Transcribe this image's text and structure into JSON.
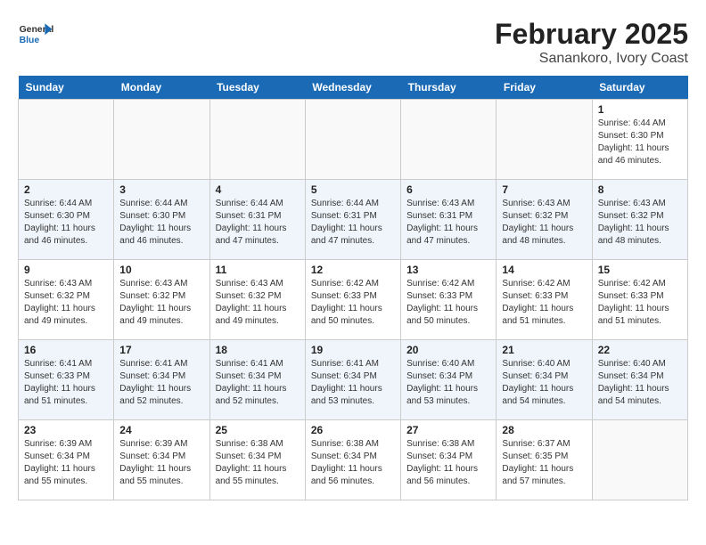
{
  "logo": {
    "general": "General",
    "blue": "Blue"
  },
  "title": "February 2025",
  "location": "Sanankoro, Ivory Coast",
  "days_of_week": [
    "Sunday",
    "Monday",
    "Tuesday",
    "Wednesday",
    "Thursday",
    "Friday",
    "Saturday"
  ],
  "weeks": [
    {
      "days": [
        {
          "num": "",
          "info": ""
        },
        {
          "num": "",
          "info": ""
        },
        {
          "num": "",
          "info": ""
        },
        {
          "num": "",
          "info": ""
        },
        {
          "num": "",
          "info": ""
        },
        {
          "num": "",
          "info": ""
        },
        {
          "num": "1",
          "info": "Sunrise: 6:44 AM\nSunset: 6:30 PM\nDaylight: 11 hours and 46 minutes."
        }
      ]
    },
    {
      "days": [
        {
          "num": "2",
          "info": "Sunrise: 6:44 AM\nSunset: 6:30 PM\nDaylight: 11 hours and 46 minutes."
        },
        {
          "num": "3",
          "info": "Sunrise: 6:44 AM\nSunset: 6:30 PM\nDaylight: 11 hours and 46 minutes."
        },
        {
          "num": "4",
          "info": "Sunrise: 6:44 AM\nSunset: 6:31 PM\nDaylight: 11 hours and 47 minutes."
        },
        {
          "num": "5",
          "info": "Sunrise: 6:44 AM\nSunset: 6:31 PM\nDaylight: 11 hours and 47 minutes."
        },
        {
          "num": "6",
          "info": "Sunrise: 6:43 AM\nSunset: 6:31 PM\nDaylight: 11 hours and 47 minutes."
        },
        {
          "num": "7",
          "info": "Sunrise: 6:43 AM\nSunset: 6:32 PM\nDaylight: 11 hours and 48 minutes."
        },
        {
          "num": "8",
          "info": "Sunrise: 6:43 AM\nSunset: 6:32 PM\nDaylight: 11 hours and 48 minutes."
        }
      ]
    },
    {
      "days": [
        {
          "num": "9",
          "info": "Sunrise: 6:43 AM\nSunset: 6:32 PM\nDaylight: 11 hours and 49 minutes."
        },
        {
          "num": "10",
          "info": "Sunrise: 6:43 AM\nSunset: 6:32 PM\nDaylight: 11 hours and 49 minutes."
        },
        {
          "num": "11",
          "info": "Sunrise: 6:43 AM\nSunset: 6:32 PM\nDaylight: 11 hours and 49 minutes."
        },
        {
          "num": "12",
          "info": "Sunrise: 6:42 AM\nSunset: 6:33 PM\nDaylight: 11 hours and 50 minutes."
        },
        {
          "num": "13",
          "info": "Sunrise: 6:42 AM\nSunset: 6:33 PM\nDaylight: 11 hours and 50 minutes."
        },
        {
          "num": "14",
          "info": "Sunrise: 6:42 AM\nSunset: 6:33 PM\nDaylight: 11 hours and 51 minutes."
        },
        {
          "num": "15",
          "info": "Sunrise: 6:42 AM\nSunset: 6:33 PM\nDaylight: 11 hours and 51 minutes."
        }
      ]
    },
    {
      "days": [
        {
          "num": "16",
          "info": "Sunrise: 6:41 AM\nSunset: 6:33 PM\nDaylight: 11 hours and 51 minutes."
        },
        {
          "num": "17",
          "info": "Sunrise: 6:41 AM\nSunset: 6:34 PM\nDaylight: 11 hours and 52 minutes."
        },
        {
          "num": "18",
          "info": "Sunrise: 6:41 AM\nSunset: 6:34 PM\nDaylight: 11 hours and 52 minutes."
        },
        {
          "num": "19",
          "info": "Sunrise: 6:41 AM\nSunset: 6:34 PM\nDaylight: 11 hours and 53 minutes."
        },
        {
          "num": "20",
          "info": "Sunrise: 6:40 AM\nSunset: 6:34 PM\nDaylight: 11 hours and 53 minutes."
        },
        {
          "num": "21",
          "info": "Sunrise: 6:40 AM\nSunset: 6:34 PM\nDaylight: 11 hours and 54 minutes."
        },
        {
          "num": "22",
          "info": "Sunrise: 6:40 AM\nSunset: 6:34 PM\nDaylight: 11 hours and 54 minutes."
        }
      ]
    },
    {
      "days": [
        {
          "num": "23",
          "info": "Sunrise: 6:39 AM\nSunset: 6:34 PM\nDaylight: 11 hours and 55 minutes."
        },
        {
          "num": "24",
          "info": "Sunrise: 6:39 AM\nSunset: 6:34 PM\nDaylight: 11 hours and 55 minutes."
        },
        {
          "num": "25",
          "info": "Sunrise: 6:38 AM\nSunset: 6:34 PM\nDaylight: 11 hours and 55 minutes."
        },
        {
          "num": "26",
          "info": "Sunrise: 6:38 AM\nSunset: 6:34 PM\nDaylight: 11 hours and 56 minutes."
        },
        {
          "num": "27",
          "info": "Sunrise: 6:38 AM\nSunset: 6:34 PM\nDaylight: 11 hours and 56 minutes."
        },
        {
          "num": "28",
          "info": "Sunrise: 6:37 AM\nSunset: 6:35 PM\nDaylight: 11 hours and 57 minutes."
        },
        {
          "num": "",
          "info": ""
        }
      ]
    }
  ]
}
